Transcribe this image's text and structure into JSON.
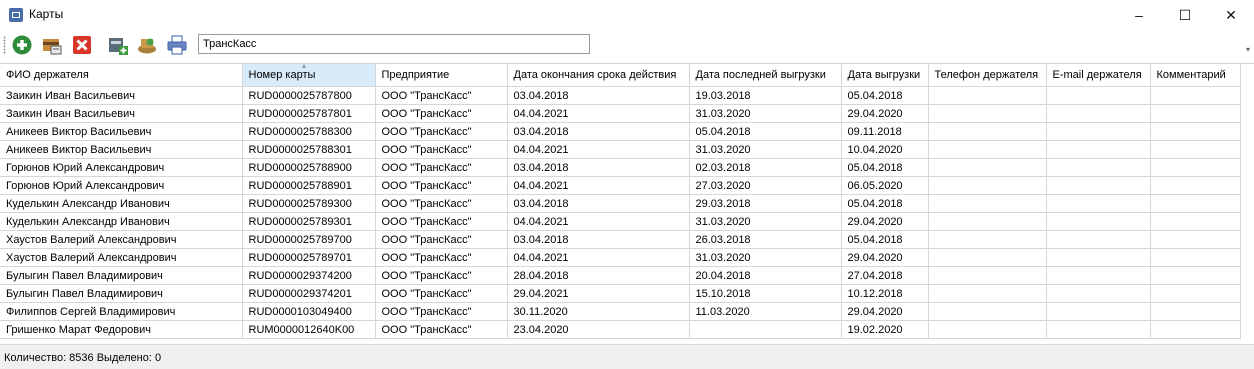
{
  "window": {
    "title": "Карты",
    "minimize": "–",
    "maximize": "☐",
    "close": "✕"
  },
  "toolbar": {
    "buttons": [
      {
        "name": "add-button",
        "icon": "plus-circle-icon",
        "color": "#2e8b3a"
      },
      {
        "name": "edit-button",
        "icon": "edit-card-icon",
        "color": "#8b5a2b"
      },
      {
        "name": "delete-button",
        "icon": "delete-x-icon",
        "color": "#d9352b"
      },
      {
        "name": "import-button",
        "icon": "import-card-icon",
        "color": "#3a7a3a"
      },
      {
        "name": "export-button",
        "icon": "export-card-icon",
        "color": "#8b6a2b"
      },
      {
        "name": "print-button",
        "icon": "printer-icon",
        "color": "#3a5fa8"
      }
    ],
    "filter_value": "ТрансКасс"
  },
  "grid": {
    "columns": [
      "ФИО держателя",
      "Номер карты",
      "Предприятие",
      "Дата окончания срока действия",
      "Дата последней выгрузки",
      "Дата выгрузки",
      "Телефон держателя",
      "E-mail держателя",
      "Комментарий"
    ],
    "rows": [
      [
        "Заикин Иван Васильевич",
        "RUD0000025787800",
        "ООО \"ТрансКасс\"",
        "03.04.2018",
        "19.03.2018",
        "05.04.2018",
        "",
        "",
        ""
      ],
      [
        "Заикин Иван Васильевич",
        "RUD0000025787801",
        "ООО \"ТрансКасс\"",
        "04.04.2021",
        "31.03.2020",
        "29.04.2020",
        "",
        "",
        ""
      ],
      [
        "Аникеев Виктор Васильевич",
        "RUD0000025788300",
        "ООО \"ТрансКасс\"",
        "03.04.2018",
        "05.04.2018",
        "09.11.2018",
        "",
        "",
        ""
      ],
      [
        "Аникеев Виктор Васильевич",
        "RUD0000025788301",
        "ООО \"ТрансКасс\"",
        "04.04.2021",
        "31.03.2020",
        "10.04.2020",
        "",
        "",
        ""
      ],
      [
        "Горюнов Юрий Александрович",
        "RUD0000025788900",
        "ООО \"ТрансКасс\"",
        "03.04.2018",
        "02.03.2018",
        "05.04.2018",
        "",
        "",
        ""
      ],
      [
        "Горюнов Юрий Александрович",
        "RUD0000025788901",
        "ООО \"ТрансКасс\"",
        "04.04.2021",
        "27.03.2020",
        "06.05.2020",
        "",
        "",
        ""
      ],
      [
        "Куделькин Александр Иванович",
        "RUD0000025789300",
        "ООО \"ТрансКасс\"",
        "03.04.2018",
        "29.03.2018",
        "05.04.2018",
        "",
        "",
        ""
      ],
      [
        "Куделькин Александр Иванович",
        "RUD0000025789301",
        "ООО \"ТрансКасс\"",
        "04.04.2021",
        "31.03.2020",
        "29.04.2020",
        "",
        "",
        ""
      ],
      [
        "Хаустов Валерий Александрович",
        "RUD0000025789700",
        "ООО \"ТрансКасс\"",
        "03.04.2018",
        "26.03.2018",
        "05.04.2018",
        "",
        "",
        ""
      ],
      [
        "Хаустов Валерий Александрович",
        "RUD0000025789701",
        "ООО \"ТрансКасс\"",
        "04.04.2021",
        "31.03.2020",
        "29.04.2020",
        "",
        "",
        ""
      ],
      [
        "Булыгин Павел Владимирович",
        "RUD0000029374200",
        "ООО \"ТрансКасс\"",
        "28.04.2018",
        "20.04.2018",
        "27.04.2018",
        "",
        "",
        ""
      ],
      [
        "Булыгин Павел Владимирович",
        "RUD0000029374201",
        "ООО \"ТрансКасс\"",
        "29.04.2021",
        "15.10.2018",
        "10.12.2018",
        "",
        "",
        ""
      ],
      [
        "Филиппов Сергей Владимирович",
        "RUD0000103049400",
        "ООО \"ТрансКасс\"",
        "30.11.2020",
        "11.03.2020",
        "29.04.2020",
        "",
        "",
        ""
      ],
      [
        "Гришенко Марат Федорович",
        "RUM0000012640K00",
        "ООО \"ТрансКасс\"",
        "23.04.2020",
        "",
        "19.02.2020",
        "",
        "",
        ""
      ]
    ]
  },
  "status": {
    "text": "Количество: 8536  Выделено: 0"
  }
}
